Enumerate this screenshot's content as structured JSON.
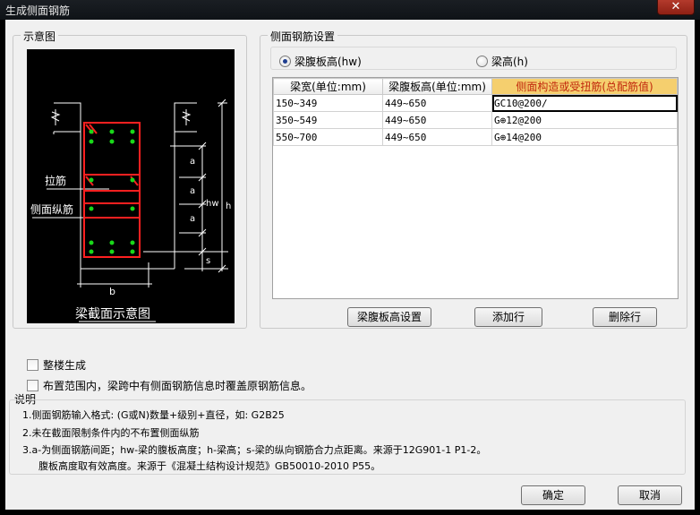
{
  "window": {
    "title": "生成侧面钢筋",
    "close_glyph": "✕"
  },
  "diagram_group": {
    "title": "示意图",
    "labels": {
      "tie": "拉筋",
      "side_bar": "侧面纵筋",
      "caption": "梁截面示意图",
      "a1": "a",
      "a2": "a",
      "a3": "a",
      "s": "s",
      "hw": "hw",
      "h": "h",
      "b": "b"
    }
  },
  "settings_group": {
    "title": "侧面钢筋设置",
    "radio_web_height": "梁腹板高(hw)",
    "radio_beam_height": "梁高(h)",
    "selected": "web_height"
  },
  "grid": {
    "headers": [
      "梁宽(单位:mm)",
      "梁腹板高(单位:mm)",
      "侧面构造或受扭筋(总配筋值)"
    ],
    "rows": [
      [
        "150~349",
        "449~650",
        "GC10@200/"
      ],
      [
        "350~549",
        "449~650",
        "G⊕12@200"
      ],
      [
        "550~700",
        "449~650",
        "G⊕14@200"
      ]
    ]
  },
  "buttons": {
    "web_height_settings": "梁腹板高设置",
    "add_row": "添加行",
    "delete_row": "删除行",
    "ok": "确定",
    "cancel": "取消"
  },
  "options": {
    "whole_building": "整楼生成",
    "overwrite": "布置范围内，梁跨中有侧面钢筋信息时覆盖原钢筋信息。"
  },
  "notes": {
    "title": "说明",
    "line1": "1.侧面钢筋输入格式: (G或N)数量+级别+直径，如: G2B25",
    "line2": "2.未在截面限制条件内的不布置侧面纵筋",
    "line3": "3.a-为侧面钢筋间距；hw-梁的腹板高度；h-梁高；s-梁的纵向钢筋合力点距离。来源于12G901-1 P1-2。",
    "line4": "腹板高度取有效高度。来源于《混凝土结构设计规范》GB50010-2010 P55。"
  }
}
